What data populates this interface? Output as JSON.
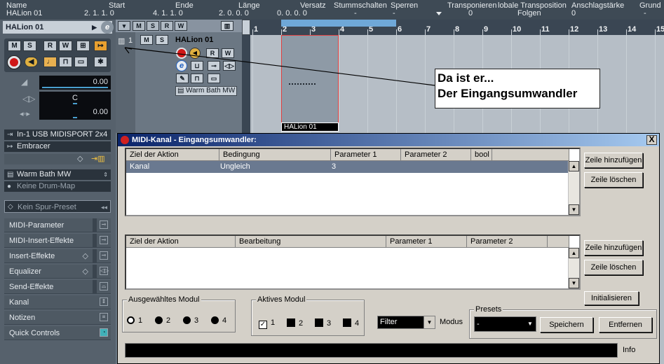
{
  "infoline": {
    "columns": [
      {
        "header": "Name",
        "value": "HALion 01"
      },
      {
        "header": "Start",
        "value": "2. 1. 1.   0"
      },
      {
        "header": "Ende",
        "value": "4. 1. 1.   0"
      },
      {
        "header": "Länge",
        "value": "2. 0. 0.   0"
      },
      {
        "header": "Versatz",
        "value": "0. 0. 0.   0"
      },
      {
        "header": "Stummschalten",
        "value": "-"
      },
      {
        "header": "Sperren",
        "value": "-"
      },
      {
        "header": "Transponieren",
        "value": "0"
      },
      {
        "header": "lobale Transposition",
        "value": "Folgen"
      },
      {
        "header": "Anschlagstärke",
        "value": "0"
      },
      {
        "header": "Grund",
        "value": "-"
      }
    ]
  },
  "inspector": {
    "track_name": "HALion 01",
    "buttons": [
      "M",
      "S",
      "R",
      "W"
    ],
    "volume": "0.00",
    "pan": "C",
    "delay": "0.00",
    "input": "In-1 USB MIDISPORT 2x4",
    "output": "Embracer",
    "program": "Warm Bath MW",
    "drum_map": "Keine Drum-Map",
    "preset": "Kein Spur-Preset",
    "sections": [
      "MIDI-Parameter",
      "MIDI-Insert-Effekte",
      "Insert-Effekte",
      "Equalizer",
      "Send-Effekte",
      "Kanal",
      "Notizen",
      "Quick Controls"
    ]
  },
  "track": {
    "number": "1",
    "name": "HALion 01",
    "buttons": [
      "M",
      "S",
      "R",
      "W"
    ],
    "program": "Warm Bath MW"
  },
  "ruler": {
    "bars": [
      "1",
      "2",
      "3",
      "4",
      "5",
      "6",
      "7",
      "8",
      "9",
      "10",
      "11",
      "12",
      "13",
      "14",
      "15"
    ]
  },
  "part": {
    "name": "HALion 01"
  },
  "annotation": {
    "line1": "Da ist er...",
    "line2": "Der Eingangsumwandler"
  },
  "dialog": {
    "title": "MIDI-Kanal - Eingangsumwandler:",
    "close": "X",
    "table1": {
      "headers": [
        "Ziel der Aktion",
        "Bedingung",
        "Parameter 1",
        "Parameter 2",
        "bool"
      ],
      "rows": [
        {
          "ziel": "Kanal",
          "bedingung": "Ungleich",
          "p1": "3",
          "p2": "",
          "bool": ""
        }
      ]
    },
    "table2": {
      "headers": [
        "Ziel der Aktion",
        "Bearbeitung",
        "Parameter 1",
        "Parameter 2"
      ]
    },
    "add_row": "Zeile hinzufügen",
    "delete_row": "Zeile löschen",
    "initialize": "Initialisieren",
    "selected_module": {
      "label": "Ausgewähltes Modul",
      "options": [
        "1",
        "2",
        "3",
        "4"
      ],
      "selected": "1"
    },
    "active_module": {
      "label": "Aktives Modul",
      "options": [
        "1",
        "2",
        "3",
        "4"
      ],
      "checked": [
        "1"
      ]
    },
    "mode": {
      "value": "Filter",
      "label": "Modus"
    },
    "presets": {
      "label": "Presets",
      "value": "-",
      "save": "Speichern",
      "remove": "Entfernen"
    },
    "info_label": "Info"
  }
}
